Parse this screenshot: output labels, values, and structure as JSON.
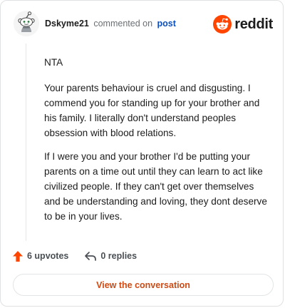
{
  "header": {
    "author": "Dskyme21",
    "commented_text": "commented on",
    "post_link": "post",
    "brand_name": "reddit"
  },
  "comment": {
    "paragraphs": [
      "NTA",
      "Your parents behaviour is cruel and disgusting. I commend you for standing up for your brother and his family. I literally don't understand peoples obsession with blood relations.",
      "If I were you and your brother I'd be putting your parents on a time out until they can learn to act like civilized people. If they can't get over themselves and be understanding and loving, they dont deserve to be in your lives."
    ]
  },
  "actions": {
    "upvotes_label": "6 upvotes",
    "replies_label": "0 replies"
  },
  "footer": {
    "view_conversation_label": "View the conversation"
  },
  "colors": {
    "brand_orange": "#ff4500",
    "link_blue": "#0b4fbf",
    "cta_orange": "#cf4a12",
    "border": "#dfe1e3"
  },
  "icons": {
    "avatar": "snoo-avatar-icon",
    "brand": "reddit-logo-icon",
    "upvote": "upvote-arrow-icon",
    "reply": "reply-arrow-icon"
  }
}
